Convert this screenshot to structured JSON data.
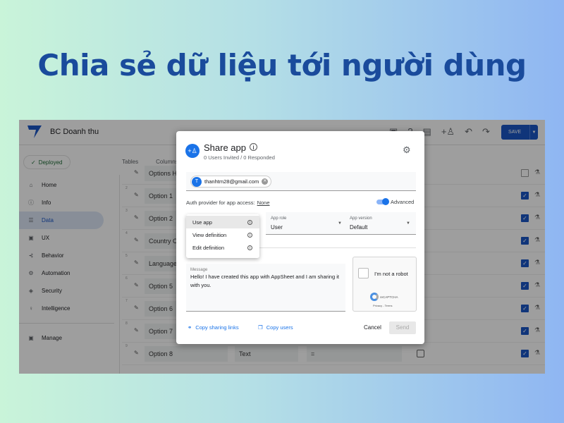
{
  "headline": "Chia sẻ dữ liệu tới người dùng",
  "app": {
    "name": "BC Doanh thu",
    "status": "Deployed",
    "save_label": "SAVE",
    "toolbar_icons": [
      "preview-icon",
      "help-icon",
      "gallery-icon",
      "add-person-icon",
      "undo-icon",
      "redo-icon"
    ]
  },
  "sidebar": {
    "items": [
      {
        "label": "Home",
        "icon": "home-icon"
      },
      {
        "label": "Info",
        "icon": "info-icon"
      },
      {
        "label": "Data",
        "icon": "data-icon",
        "active": true
      },
      {
        "label": "UX",
        "icon": "ux-icon"
      },
      {
        "label": "Behavior",
        "icon": "behavior-icon"
      },
      {
        "label": "Automation",
        "icon": "automation-icon"
      },
      {
        "label": "Security",
        "icon": "shield-icon"
      },
      {
        "label": "Intelligence",
        "icon": "bulb-icon"
      }
    ],
    "manage": "Manage"
  },
  "tabs": [
    "Tables",
    "Columns"
  ],
  "rows": [
    {
      "num": "",
      "name": "Options H",
      "checked": false
    },
    {
      "num": "2",
      "name": "Option 1",
      "checked": true
    },
    {
      "num": "3",
      "name": "Option 2",
      "checked": true
    },
    {
      "num": "4",
      "name": "Country C",
      "checked": true
    },
    {
      "num": "5",
      "name": "Language",
      "checked": true
    },
    {
      "num": "6",
      "name": "Option 5",
      "checked": true
    },
    {
      "num": "7",
      "name": "Option 6",
      "checked": true
    },
    {
      "num": "8",
      "name": "Option 7",
      "checked": true
    },
    {
      "num": "9",
      "name": "Option 8",
      "type": "Text",
      "formula": "=",
      "checked": true
    }
  ],
  "dialog": {
    "title": "Share app",
    "subtitle": "0 Users Invited / 0 Responded",
    "chip_initial": "T",
    "chip_email": "thanhtm28@gmail.com",
    "auth_label": "Auth provider for app access:",
    "auth_value": "None",
    "advanced_label": "Advanced",
    "advanced_on": true,
    "menu": [
      "Use app",
      "View definition",
      "Edit definition"
    ],
    "app_role_label": "App role",
    "app_role_value": "User",
    "app_version_label": "App version",
    "app_version_value": "Default",
    "message_label": "Message",
    "message_value": "Hello! I have created this app with AppSheet and I am sharing it with you.",
    "captcha_text": "I'm not a robot",
    "captcha_brand": "reCAPTCHA",
    "captcha_links": "Privacy - Terms",
    "copy_links": "Copy sharing links",
    "copy_users": "Copy users",
    "cancel": "Cancel",
    "send": "Send"
  }
}
